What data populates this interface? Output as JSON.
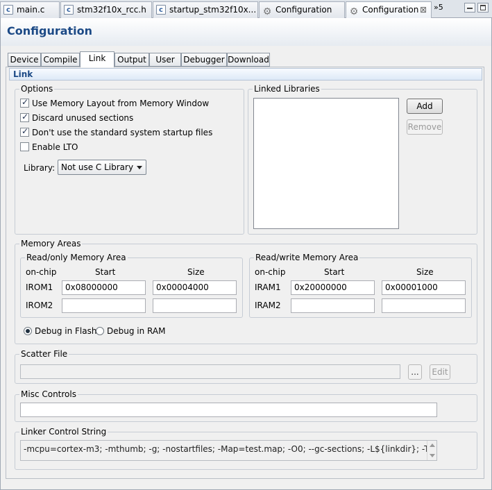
{
  "editor_tabs": [
    {
      "label": "main.c",
      "icon": "c-file-icon"
    },
    {
      "label": "stm32f10x_rcc.h",
      "icon": "c-file-icon"
    },
    {
      "label": "startup_stm32f10x...",
      "icon": "c-file-icon"
    },
    {
      "label": "Configuration",
      "icon": "gear-icon"
    },
    {
      "label": "Configuration",
      "icon": "gear-icon",
      "active": true
    }
  ],
  "overflow_label": "»5",
  "page_title": "Configuration",
  "config_tabs": [
    "Device",
    "Compile",
    "Link",
    "Output",
    "User",
    "Debugger",
    "Download"
  ],
  "active_config_tab": "Link",
  "section_title": "Link",
  "options": {
    "label": "Options",
    "checkboxes": [
      {
        "label": "Use Memory Layout from Memory Window",
        "checked": true
      },
      {
        "label": "Discard unused sections",
        "checked": true
      },
      {
        "label": "Don't use the standard system startup files",
        "checked": true
      },
      {
        "label": "Enable LTO",
        "checked": false
      }
    ],
    "library_label": "Library:",
    "library_value": "Not use C Library"
  },
  "linked_libraries": {
    "label": "Linked Libraries",
    "add_label": "Add",
    "remove_label": "Remove"
  },
  "memory_areas": {
    "label": "Memory Areas",
    "readonly": {
      "label": "Read/only Memory Area",
      "col_onchip": "on-chip",
      "col_start": "Start",
      "col_size": "Size",
      "rows": [
        {
          "name": "IROM1",
          "start": "0x08000000",
          "size": "0x00004000"
        },
        {
          "name": "IROM2",
          "start": "",
          "size": ""
        }
      ]
    },
    "readwrite": {
      "label": "Read/write Memory Area",
      "col_onchip": "on-chip",
      "col_start": "Start",
      "col_size": "Size",
      "rows": [
        {
          "name": "IRAM1",
          "start": "0x20000000",
          "size": "0x00001000"
        },
        {
          "name": "IRAM2",
          "start": "",
          "size": ""
        }
      ]
    },
    "debug_flash_label": "Debug in Flash",
    "debug_ram_label": "Debug in RAM",
    "debug_selected": "flash"
  },
  "scatter_file": {
    "label": "Scatter File",
    "value": "",
    "browse_label": "...",
    "edit_label": "Edit"
  },
  "misc_controls": {
    "label": "Misc Controls",
    "value": ""
  },
  "linker_control": {
    "label": "Linker Control String",
    "value": "-mcpu=cortex-m3; -mthumb; -g; -nostartfiles; -Map=test.map; -O0; --gc-sections; -L${linkdir}; -T${linkdir}/a"
  }
}
